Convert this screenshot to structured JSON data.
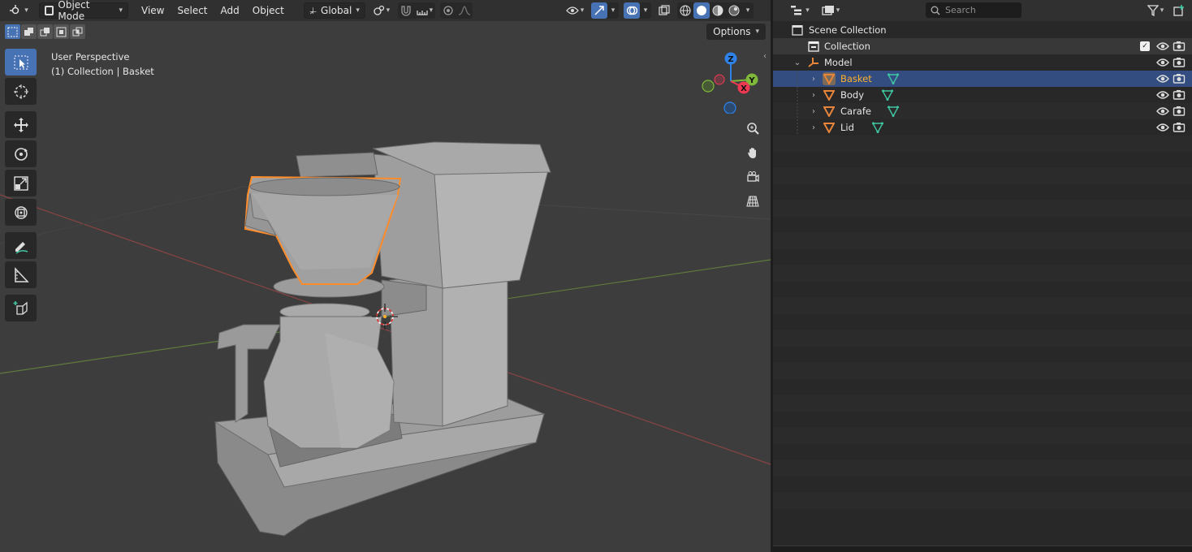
{
  "viewport": {
    "header": {
      "mode_label": "Object Mode",
      "menus": [
        "View",
        "Select",
        "Add",
        "Object"
      ],
      "transform_orientation": "Global"
    },
    "options_label": "Options",
    "info": {
      "view_name": "User Perspective",
      "context": "(1) Collection | Basket"
    },
    "gizmo_axes": {
      "z": "Z",
      "y": "Y",
      "x": "X"
    }
  },
  "outliner": {
    "search_placeholder": "Search",
    "rows": [
      {
        "label": "Scene Collection",
        "type": "scene"
      },
      {
        "label": "Collection",
        "type": "collection"
      },
      {
        "label": "Model",
        "type": "empty"
      },
      {
        "label": "Basket",
        "type": "mesh",
        "selected": true
      },
      {
        "label": "Body",
        "type": "mesh"
      },
      {
        "label": "Carafe",
        "type": "mesh"
      },
      {
        "label": "Lid",
        "type": "mesh"
      }
    ]
  },
  "colors": {
    "accent_blue": "#4772b3",
    "selection_orange": "#ffaf29",
    "mesh_orange": "#e8853a",
    "mesh_data_green": "#3fc7a3",
    "axis_x": "#ed3a52",
    "axis_y": "#7fb83a",
    "axis_z": "#2f83e8"
  }
}
